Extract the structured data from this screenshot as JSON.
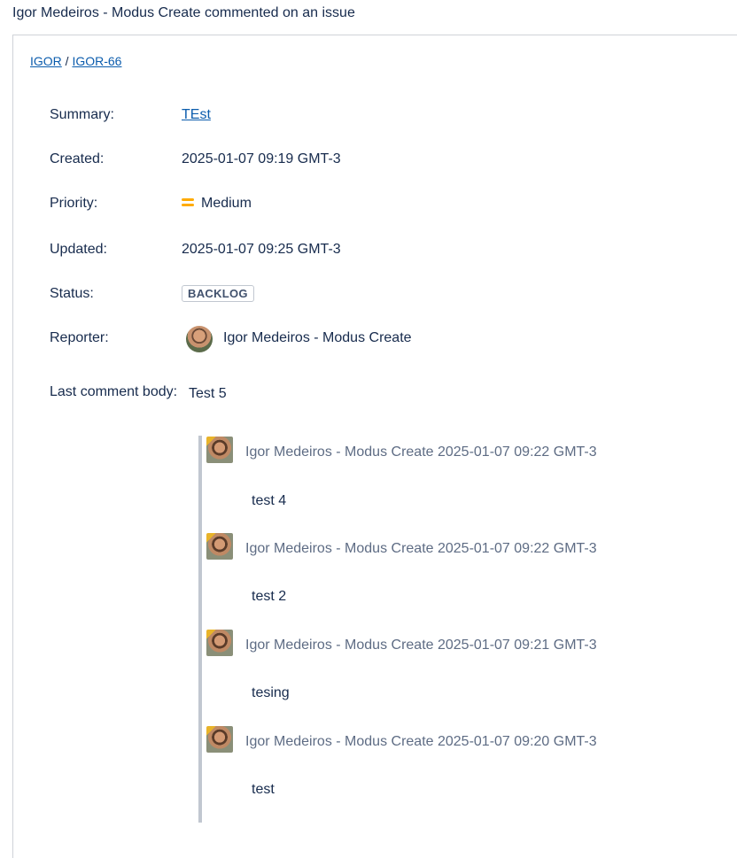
{
  "notification": {
    "heading": "Igor Medeiros - Modus Create commented on an issue"
  },
  "breadcrumb": {
    "project": "IGOR",
    "separator": "/",
    "issue_key": "IGOR-66"
  },
  "fields": {
    "summary_label": "Summary:",
    "summary_value": "TEst",
    "created_label": "Created:",
    "created_value": "2025-01-07 09:19 GMT-3",
    "priority_label": "Priority:",
    "priority_value": "Medium",
    "priority_icon": "priority-medium-icon",
    "priority_color": "#FFAB00",
    "updated_label": "Updated:",
    "updated_value": "2025-01-07 09:25 GMT-3",
    "status_label": "Status:",
    "status_value": "BACKLOG",
    "reporter_label": "Reporter:",
    "reporter_value": "Igor Medeiros - Modus Create",
    "last_comment_label": "Last comment body:",
    "last_comment_value": "Test 5"
  },
  "comments": [
    {
      "author": "Igor Medeiros - Modus Create",
      "timestamp": "2025-01-07 09:22 GMT-3",
      "body": "test 4"
    },
    {
      "author": "Igor Medeiros - Modus Create",
      "timestamp": "2025-01-07 09:22 GMT-3",
      "body": "test 2"
    },
    {
      "author": "Igor Medeiros - Modus Create",
      "timestamp": "2025-01-07 09:21 GMT-3",
      "body": "tesing"
    },
    {
      "author": "Igor Medeiros - Modus Create",
      "timestamp": "2025-01-07 09:20 GMT-3",
      "body": "test"
    }
  ],
  "colors": {
    "link": "#0B5CAD",
    "text": "#172B4D",
    "muted": "#5E6C84",
    "thread_bar": "#C1C7D0"
  }
}
